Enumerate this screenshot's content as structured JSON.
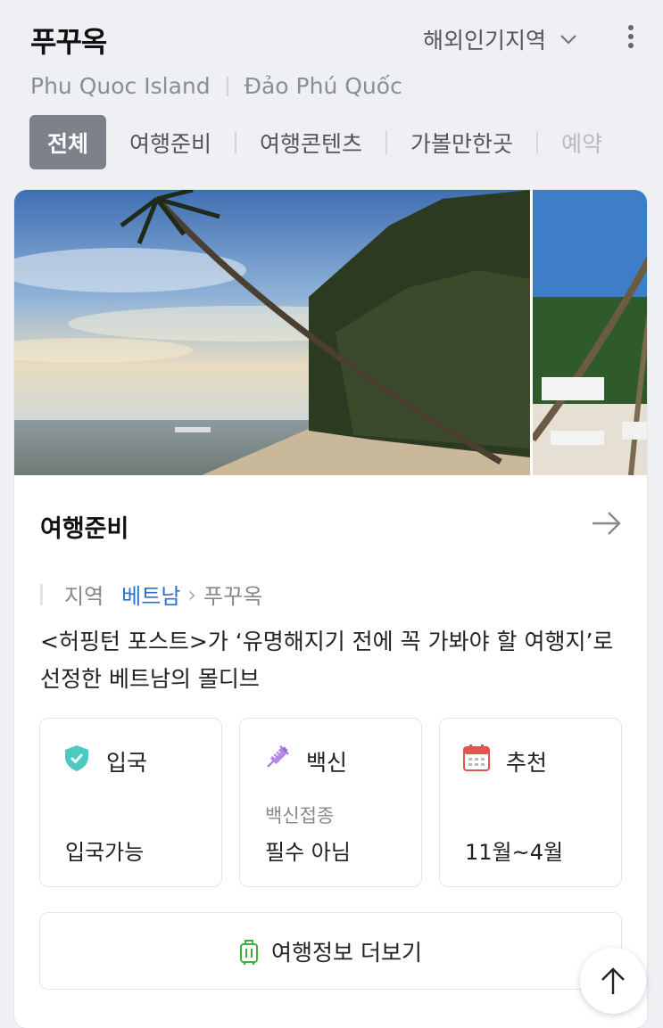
{
  "header": {
    "title": "푸꾸옥",
    "region_select": "해외인기지역",
    "subtitle_en": "Phu Quoc Island",
    "subtitle_vi": "Đảo Phú Quốc"
  },
  "tabs": [
    {
      "label": "전체",
      "active": true
    },
    {
      "label": "여행준비",
      "active": false
    },
    {
      "label": "여행콘텐츠",
      "active": false
    },
    {
      "label": "가볼만한곳",
      "active": false
    },
    {
      "label": "예약",
      "active": false
    }
  ],
  "card": {
    "section_title": "여행준비",
    "breadcrumb": {
      "label": "지역",
      "country": "베트남",
      "city": "푸꾸옥"
    },
    "description": "<허핑턴 포스트>가 ‘유명해지기 전에 꼭 가봐야 할 여행지’로 선정한 베트남의 몰디브",
    "info": [
      {
        "icon": "shield-check-icon",
        "label": "입국",
        "sub": "",
        "value": "입국가능"
      },
      {
        "icon": "syringe-icon",
        "label": "백신",
        "sub": "백신접종",
        "value": "필수 아님"
      },
      {
        "icon": "calendar-icon",
        "label": "추천",
        "sub": "",
        "value": "11월~4월"
      }
    ],
    "more_button": "여행정보 더보기"
  },
  "colors": {
    "accent_blue": "#2f6fd0",
    "active_tab": "#7d828a",
    "shield": "#4cc9c0",
    "syringe": "#9b6ad6",
    "calendar": "#e2554f",
    "bag": "#3fae3f"
  }
}
